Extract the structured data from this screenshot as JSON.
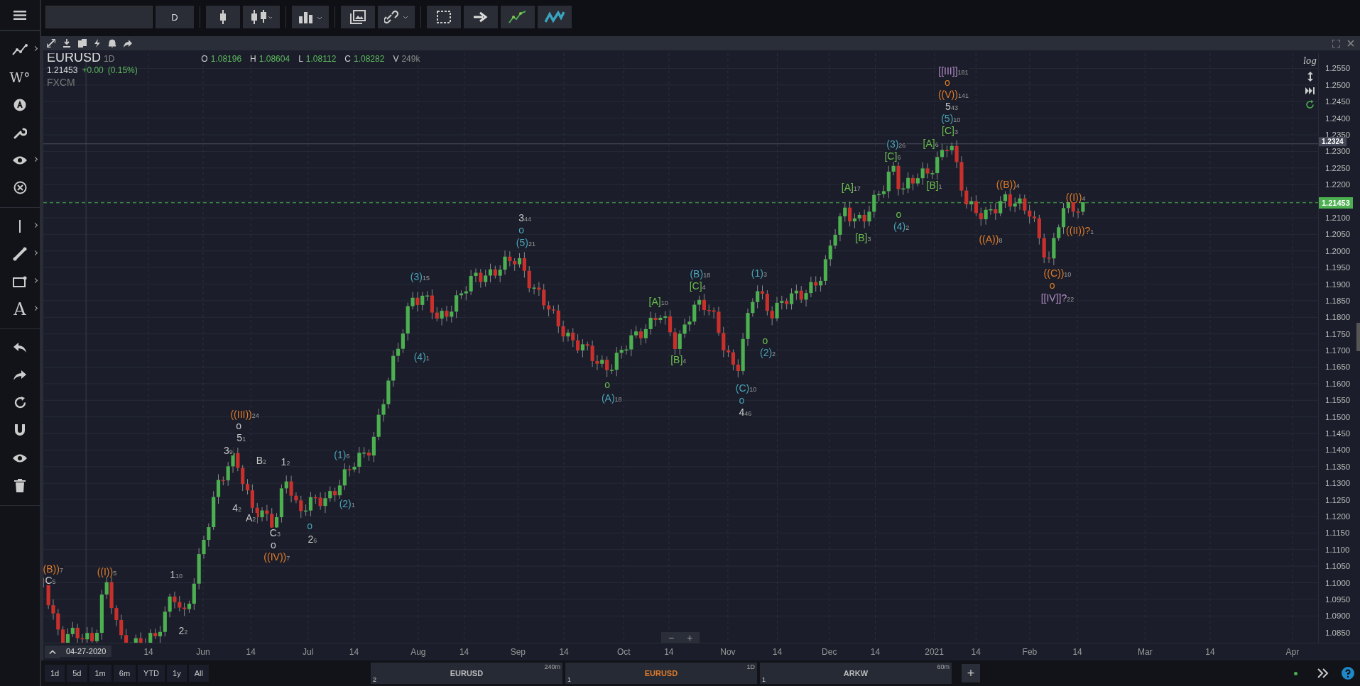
{
  "top_bar": {
    "interval": "D"
  },
  "left_toolbar": {
    "degree_tool": "W°",
    "text_tool": "A"
  },
  "chart": {
    "symbol": "EURUSD",
    "interval": "1D",
    "ohlcv": [
      {
        "key": "O",
        "value": "1.08196",
        "kind": "price"
      },
      {
        "key": "H",
        "value": "1.08604",
        "kind": "price"
      },
      {
        "key": "L",
        "value": "1.08112",
        "kind": "price"
      },
      {
        "key": "C",
        "value": "1.08282",
        "kind": "price"
      },
      {
        "key": "V",
        "value": "249k",
        "kind": "volume"
      }
    ],
    "last": "1.21453",
    "change": "+0.00",
    "change_pct": "(0.15%)",
    "source": "FXCM",
    "scale_mode": "log",
    "price_axis": [
      "1.2550",
      "1.2500",
      "1.2450",
      "1.2400",
      "1.2350",
      "1.2300",
      "1.2250",
      "1.2200",
      "1.2100",
      "1.2050",
      "1.2000",
      "1.1950",
      "1.1900",
      "1.1850",
      "1.1800",
      "1.1750",
      "1.1700",
      "1.1650",
      "1.1600",
      "1.1550",
      "1.1500",
      "1.1450",
      "1.1400",
      "1.1350",
      "1.1300",
      "1.1250",
      "1.1200",
      "1.1150",
      "1.1100",
      "1.1050",
      "1.1000",
      "1.0950",
      "1.0900",
      "1.0850"
    ],
    "price_tags": [
      {
        "kind": "line",
        "text": "1.2324"
      },
      {
        "kind": "last",
        "text": "1.21453"
      }
    ],
    "cursor_date": "04-27-2020",
    "time_axis": [
      "14",
      "Jun",
      "14",
      "Jul",
      "14",
      "Aug",
      "14",
      "Sep",
      "14",
      "Oct",
      "14",
      "Nov",
      "14",
      "Dec",
      "14",
      "2021",
      "14",
      "Feb",
      "14",
      "Mar",
      "14",
      "Apr"
    ],
    "zoom_controls": [
      "−",
      "+"
    ],
    "wave_labels": [
      {
        "text": "(B))",
        "count": "7",
        "color": "#e07b2a"
      },
      {
        "text": "C",
        "count": "5",
        "color": "#c8c8c8"
      },
      {
        "text": "((I))",
        "count": "5",
        "color": "#e07b2a"
      },
      {
        "text": "1",
        "count": "10",
        "color": "#c8c8c8"
      },
      {
        "text": "2",
        "count": "2",
        "color": "#c8c8c8"
      },
      {
        "text": "((III))",
        "count": "24",
        "color": "#e07b2a"
      },
      {
        "text": "o",
        "color": "#c8c8c8"
      },
      {
        "text": "5",
        "count": "1",
        "color": "#c8c8c8"
      },
      {
        "text": "3",
        "count": "9",
        "color": "#c8c8c8"
      },
      {
        "text": "4",
        "count": "2",
        "color": "#c8c8c8"
      },
      {
        "text": "B",
        "count": "2",
        "color": "#c8c8c8"
      },
      {
        "text": "A",
        "count": "2",
        "color": "#c8c8c8"
      },
      {
        "text": "1",
        "count": "2",
        "color": "#c8c8c8"
      },
      {
        "text": "C",
        "count": "3",
        "color": "#c8c8c8"
      },
      {
        "text": "o",
        "color": "#c8c8c8"
      },
      {
        "text": "((IV))",
        "count": "7",
        "color": "#e07b2a"
      },
      {
        "text": "(1)",
        "count": "6",
        "color": "#4aa3b8"
      },
      {
        "text": "(2)",
        "count": "1",
        "color": "#4aa3b8"
      },
      {
        "text": "o",
        "color": "#4aa3b8"
      },
      {
        "text": "2",
        "count": "6",
        "color": "#c8c8c8"
      },
      {
        "text": "(3)",
        "count": "15",
        "color": "#4aa3b8"
      },
      {
        "text": "(4)",
        "count": "1",
        "color": "#4aa3b8"
      },
      {
        "text": "3",
        "count": "44",
        "color": "#c8c8c8"
      },
      {
        "text": "o",
        "color": "#4aa3b8"
      },
      {
        "text": "(5)",
        "count": "21",
        "color": "#4aa3b8"
      },
      {
        "text": "o",
        "color": "#6bbf4e"
      },
      {
        "text": "(A)",
        "count": "18",
        "color": "#4aa3b8"
      },
      {
        "text": "[A]",
        "count": "10",
        "color": "#6bbf4e"
      },
      {
        "text": "(B)",
        "count": "18",
        "color": "#4aa3b8"
      },
      {
        "text": "[C]",
        "count": "4",
        "color": "#6bbf4e"
      },
      {
        "text": "[B]",
        "count": "4",
        "color": "#6bbf4e"
      },
      {
        "text": "(1)",
        "count": "3",
        "color": "#4aa3b8"
      },
      {
        "text": "o",
        "color": "#6bbf4e"
      },
      {
        "text": "(2)",
        "count": "2",
        "color": "#4aa3b8"
      },
      {
        "text": "(C)",
        "count": "10",
        "color": "#4aa3b8"
      },
      {
        "text": "o",
        "color": "#4aa3b8"
      },
      {
        "text": "4",
        "count": "46",
        "color": "#c8c8c8"
      },
      {
        "text": "[A]",
        "count": "17",
        "color": "#6bbf4e"
      },
      {
        "text": "[B]",
        "count": "3",
        "color": "#6bbf4e"
      },
      {
        "text": "(3)",
        "count": "26",
        "color": "#4aa3b8"
      },
      {
        "text": "[C]",
        "count": "6",
        "color": "#6bbf4e"
      },
      {
        "text": "o",
        "color": "#6bbf4e"
      },
      {
        "text": "(4)",
        "count": "2",
        "color": "#4aa3b8"
      },
      {
        "text": "[A]",
        "count": "6",
        "color": "#6bbf4e"
      },
      {
        "text": "[B]",
        "count": "1",
        "color": "#6bbf4e"
      },
      {
        "text": "[[III]]",
        "count": "181",
        "color": "#b48cc8"
      },
      {
        "text": "o",
        "color": "#e07b2a"
      },
      {
        "text": "((V))",
        "count": "141",
        "color": "#e07b2a"
      },
      {
        "text": "5",
        "count": "43",
        "color": "#c8c8c8"
      },
      {
        "text": "(5)",
        "count": "10",
        "color": "#4aa3b8"
      },
      {
        "text": "[C]",
        "count": "3",
        "color": "#6bbf4e"
      },
      {
        "text": "((B))",
        "count": "4",
        "color": "#e07b2a"
      },
      {
        "text": "((A))",
        "count": "8",
        "color": "#e07b2a"
      },
      {
        "text": "((C))",
        "count": "10",
        "color": "#e07b2a"
      },
      {
        "text": "o",
        "color": "#e07b2a"
      },
      {
        "text": "[[IV]]?",
        "count": "22",
        "color": "#b48cc8"
      },
      {
        "text": "((I))",
        "count": "4",
        "color": "#e07b2a"
      },
      {
        "text": "((II))?",
        "count": "1",
        "color": "#e07b2a"
      }
    ]
  },
  "bottom_bar": {
    "ranges": [
      "1d",
      "5d",
      "1m",
      "6m",
      "YTD",
      "1y",
      "All"
    ],
    "tabs": [
      {
        "symbol": "EURUSD",
        "interval": "240m",
        "count": "2",
        "selected": false
      },
      {
        "symbol": "EURUSD",
        "interval": "1D",
        "count": "1",
        "selected": true
      },
      {
        "symbol": "ARKW",
        "interval": "60m",
        "count": "1",
        "selected": false
      }
    ],
    "add": "+"
  }
}
